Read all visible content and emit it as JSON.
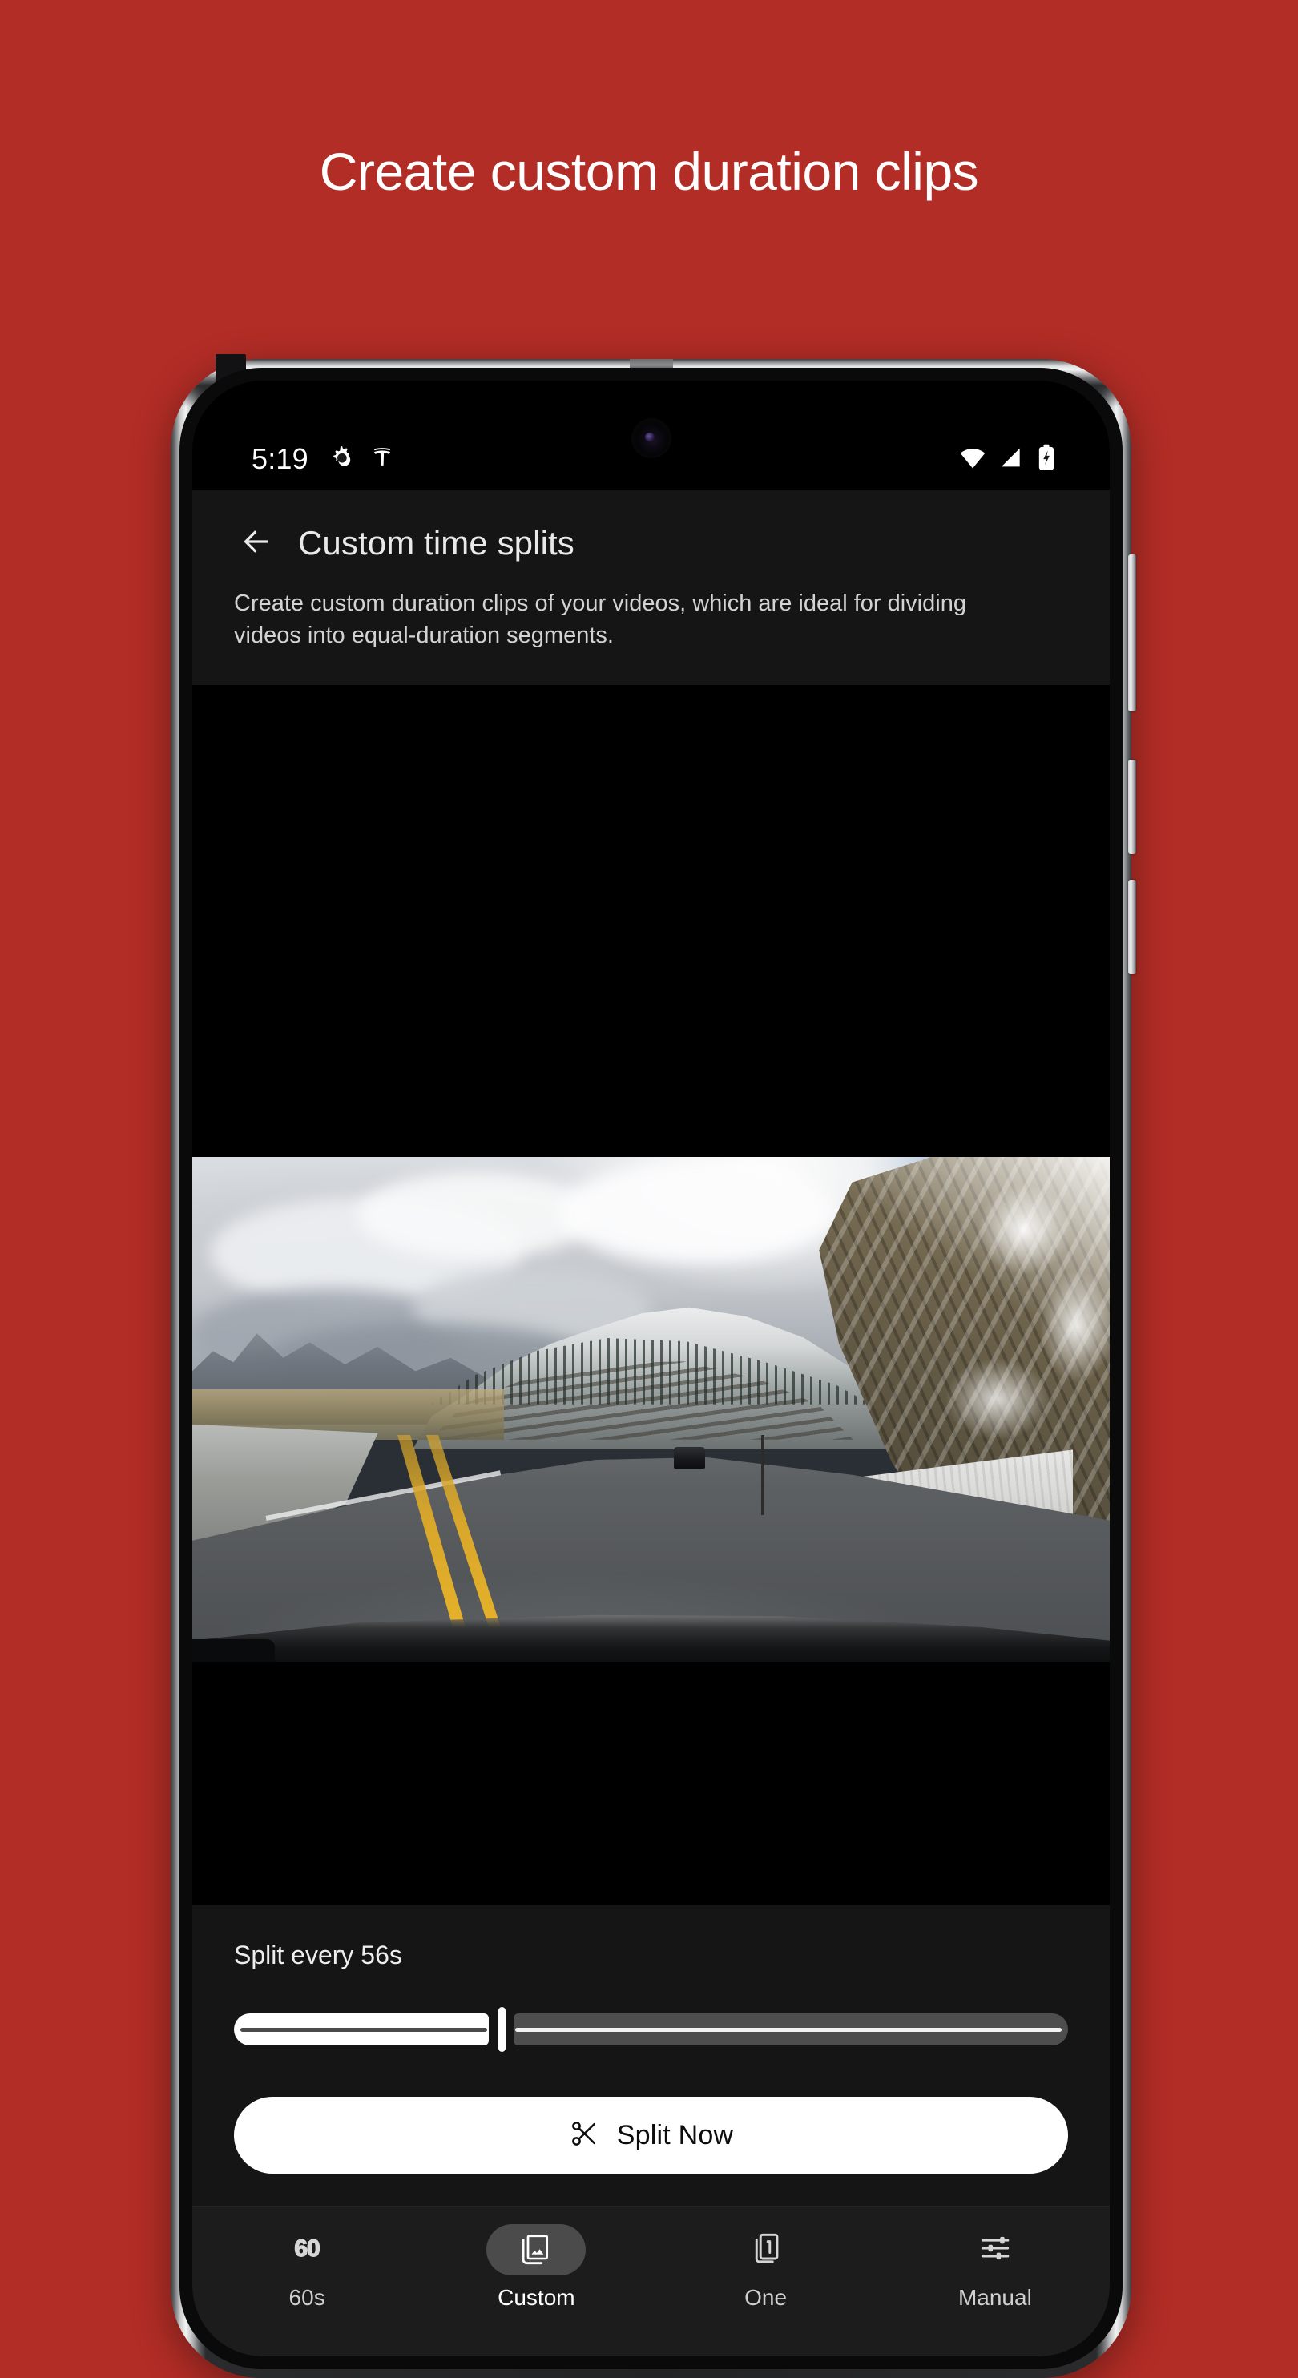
{
  "promo": {
    "headline": "Create custom duration clips",
    "background_color": "#b22d26"
  },
  "phone": {
    "status_bar": {
      "time": "5:19",
      "left_icons": [
        "app-gear-icon",
        "tesla-logo-icon"
      ],
      "right_icons": [
        "wifi-icon",
        "cellular-signal-icon",
        "battery-charging-icon"
      ]
    },
    "header": {
      "back_icon": "back-arrow-icon",
      "title": "Custom time splits",
      "description": "Create custom duration clips of your videos, which are ideal for dividing videos into equal-duration segments."
    },
    "preview": {
      "media_type": "dashcam-video-frame",
      "alt": "Snowy mountain road viewed from a car dashcam"
    },
    "controls": {
      "split_label": "Split every 56s",
      "slider": {
        "value": 56,
        "min": 1,
        "max": 180,
        "fill_percent": 31
      },
      "primary_button": {
        "label": "Split Now",
        "icon": "scissors-icon",
        "background_color": "#ffffff",
        "text_color": "#0d0d0d"
      }
    },
    "bottom_nav": {
      "selected": "Custom",
      "items": [
        {
          "label": "60s",
          "icon": "sixty-numerals-icon",
          "active": false
        },
        {
          "label": "Custom",
          "icon": "photo-library-icon",
          "active": true
        },
        {
          "label": "One",
          "icon": "single-page-one-icon",
          "active": false
        },
        {
          "label": "Manual",
          "icon": "tune-sliders-icon",
          "active": false
        }
      ]
    }
  }
}
